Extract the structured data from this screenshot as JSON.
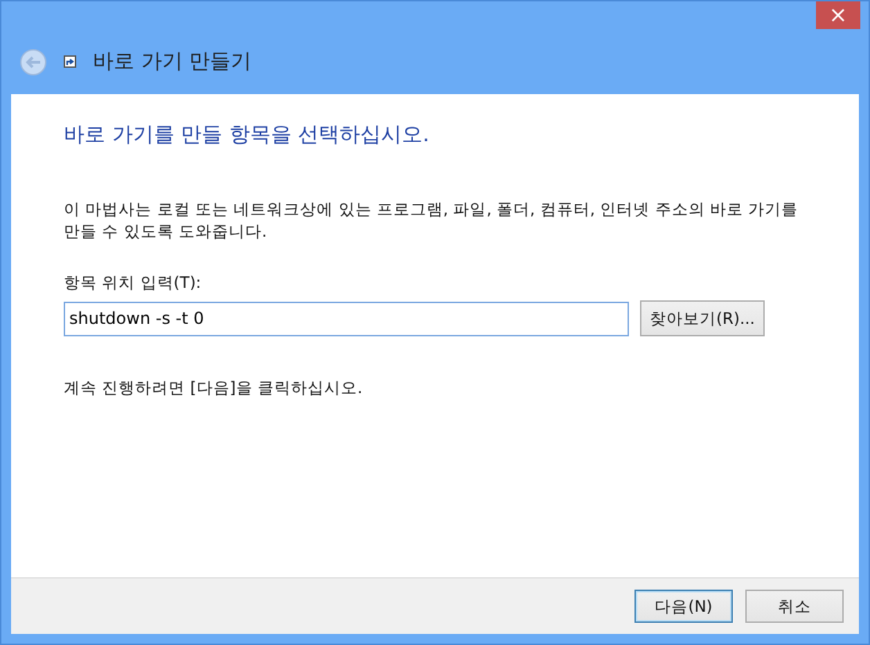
{
  "window": {
    "title": "바로 가기 만들기",
    "close": "×"
  },
  "heading": "바로 가기를 만들 항목을 선택하십시오.",
  "description": "이 마법사는 로컬 또는 네트워크상에 있는 프로그램, 파일, 폴더, 컴퓨터, 인터넷 주소의 바로 가기를 만들 수 있도록 도와줍니다.",
  "location": {
    "label": "항목 위치 입력(T):",
    "value": "shutdown -s -t 0",
    "browse": "찾아보기(R)..."
  },
  "hint": "계속 진행하려면 [다음]을 클릭하십시오.",
  "buttons": [
    {
      "label": "다음(N)",
      "default": true
    },
    {
      "label": "취소",
      "default": false
    }
  ]
}
